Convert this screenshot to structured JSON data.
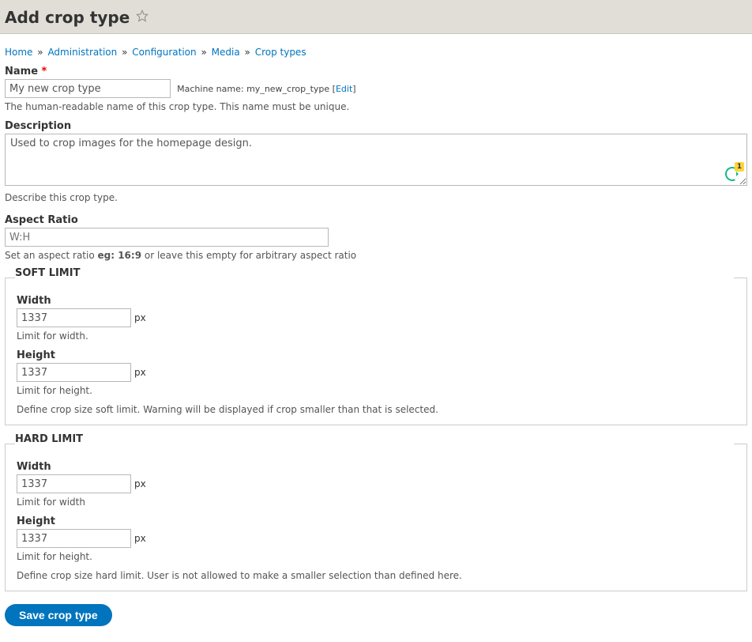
{
  "title": "Add crop type",
  "breadcrumb": [
    "Home",
    "Administration",
    "Configuration",
    "Media",
    "Crop types"
  ],
  "name": {
    "label": "Name",
    "value": "My new crop type",
    "machine_prefix": "Machine name:",
    "machine_name": "my_new_crop_type",
    "edit_label": "Edit",
    "description": "The human-readable name of this crop type. This name must be unique."
  },
  "description_field": {
    "label": "Description",
    "value": "Used to crop images for the homepage design.",
    "help": "Describe this crop type.",
    "grammarly_count": "1"
  },
  "aspect": {
    "label": "Aspect Ratio",
    "placeholder": "W:H",
    "help_pre": "Set an aspect ratio ",
    "help_bold": "eg: 16:9",
    "help_post": " or leave this empty for arbitrary aspect ratio"
  },
  "soft": {
    "legend": "SOFT LIMIT",
    "width_label": "Width",
    "width_value": "1337",
    "width_help": "Limit for width.",
    "height_label": "Height",
    "height_value": "1337",
    "height_help": "Limit for height.",
    "unit": "px",
    "note": "Define crop size soft limit. Warning will be displayed if crop smaller than that is selected."
  },
  "hard": {
    "legend": "HARD LIMIT",
    "width_label": "Width",
    "width_value": "1337",
    "width_help": "Limit for width",
    "height_label": "Height",
    "height_value": "1337",
    "height_help": "Limit for height.",
    "unit": "px",
    "note": "Define crop size hard limit. User is not allowed to make a smaller selection than defined here."
  },
  "save_label": "Save crop type"
}
